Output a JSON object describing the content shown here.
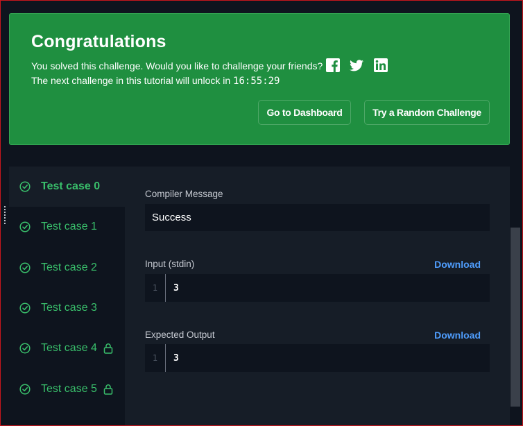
{
  "banner": {
    "title": "Congratulations",
    "line1": "You solved this challenge. Would you like to challenge your friends?",
    "line2_prefix": "The next challenge in this tutorial will unlock in",
    "timer": "16:55:29",
    "social_icons": [
      "facebook-icon",
      "twitter-icon",
      "linkedin-icon"
    ],
    "dashboard_button": "Go to Dashboard",
    "random_button": "Try a Random Challenge",
    "color": "#1f8f40"
  },
  "test_cases": [
    {
      "label": "Test case 0",
      "locked": false,
      "active": true
    },
    {
      "label": "Test case 1",
      "locked": false,
      "active": false
    },
    {
      "label": "Test case 2",
      "locked": false,
      "active": false
    },
    {
      "label": "Test case 3",
      "locked": false,
      "active": false
    },
    {
      "label": "Test case 4",
      "locked": true,
      "active": false
    },
    {
      "label": "Test case 5",
      "locked": true,
      "active": false
    }
  ],
  "result": {
    "compiler_label": "Compiler Message",
    "compiler_message": "Success",
    "input_label": "Input (stdin)",
    "input_download": "Download",
    "input_line_no": "1",
    "input_value": "3",
    "output_label": "Expected Output",
    "output_download": "Download",
    "output_line_no": "1",
    "output_value": "3"
  },
  "colors": {
    "accent_green": "#39bf6b",
    "link_blue": "#4f9dfd",
    "background": "#0e141e",
    "panel": "#161d27"
  }
}
